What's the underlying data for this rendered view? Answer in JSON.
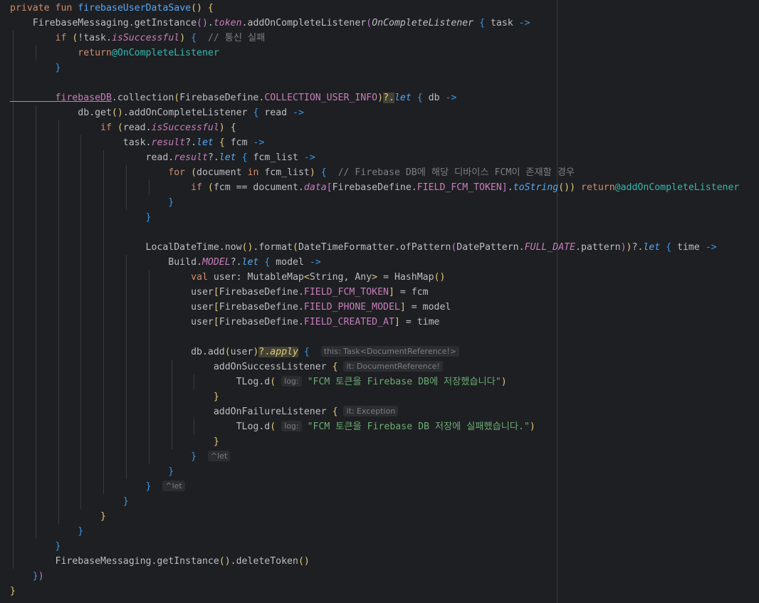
{
  "editor": {
    "language": "Kotlin",
    "lines": [
      [
        [
          "kw",
          "private fun "
        ],
        [
          "fn",
          "firebaseUserDataSave"
        ],
        [
          "brace1",
          "() {"
        ]
      ],
      [
        [
          "plain",
          "    FirebaseMessaging.getInstance"
        ],
        [
          "brace2",
          "()"
        ],
        [
          "plain",
          "."
        ],
        [
          "ital",
          "token"
        ],
        [
          "plain",
          ".addOnCompleteListener"
        ],
        [
          "brace2",
          "("
        ],
        [
          "type",
          "OnCompleteListener"
        ],
        [
          "plain",
          " "
        ],
        [
          "brace3",
          "{"
        ],
        [
          "plain",
          " task "
        ],
        [
          "arrow",
          "->"
        ]
      ],
      [
        [
          "kw",
          "        if "
        ],
        [
          "brace1",
          "("
        ],
        [
          "plain",
          "!task."
        ],
        [
          "ital",
          "isSuccessful"
        ],
        [
          "brace1",
          ")"
        ],
        [
          "plain",
          " "
        ],
        [
          "brace3",
          "{"
        ],
        [
          "comment",
          "  // 통신 실패"
        ]
      ],
      [
        [
          "kw",
          "            return"
        ],
        [
          "label",
          "@OnCompleteListener"
        ]
      ],
      [
        [
          "brace3",
          "        }"
        ]
      ],
      [
        [
          "plain",
          ""
        ]
      ],
      [
        [
          "under",
          "        firebaseDB"
        ],
        [
          "plain",
          ".collection"
        ],
        [
          "brace1",
          "("
        ],
        [
          "plain",
          "FirebaseDefine."
        ],
        [
          "static",
          "COLLECTION_USER_INFO"
        ],
        [
          "brace1",
          ")"
        ],
        [
          "hl",
          "?."
        ],
        [
          "ext",
          "let"
        ],
        [
          "plain",
          " "
        ],
        [
          "brace3",
          "{"
        ],
        [
          "plain",
          " db "
        ],
        [
          "arrow",
          "->"
        ]
      ],
      [
        [
          "plain",
          "            db.get"
        ],
        [
          "brace1",
          "()"
        ],
        [
          "plain",
          ".addOnCompleteListener "
        ],
        [
          "brace3",
          "{"
        ],
        [
          "plain",
          " read "
        ],
        [
          "arrow",
          "->"
        ]
      ],
      [
        [
          "kw",
          "                if "
        ],
        [
          "brace1",
          "("
        ],
        [
          "plain",
          "read."
        ],
        [
          "ital",
          "isSuccessful"
        ],
        [
          "brace1",
          ")"
        ],
        [
          "plain",
          " "
        ],
        [
          "brace1",
          "{"
        ]
      ],
      [
        [
          "plain",
          "                    task."
        ],
        [
          "ital",
          "result"
        ],
        [
          "plain",
          "?."
        ],
        [
          "ext",
          "let"
        ],
        [
          "plain",
          " "
        ],
        [
          "brace4",
          "{"
        ],
        [
          "plain",
          " fcm "
        ],
        [
          "arrow",
          "->"
        ]
      ],
      [
        [
          "plain",
          "                        read."
        ],
        [
          "ital",
          "result"
        ],
        [
          "plain",
          "?."
        ],
        [
          "ext",
          "let"
        ],
        [
          "plain",
          " "
        ],
        [
          "brace3",
          "{"
        ],
        [
          "plain",
          " fcm_list "
        ],
        [
          "arrow",
          "->"
        ]
      ],
      [
        [
          "kw",
          "                            for "
        ],
        [
          "brace1",
          "("
        ],
        [
          "plain",
          "document "
        ],
        [
          "kw",
          "in"
        ],
        [
          "plain",
          " fcm_list"
        ],
        [
          "brace1",
          ")"
        ],
        [
          "plain",
          " "
        ],
        [
          "brace3",
          "{"
        ],
        [
          "comment",
          "  // Firebase DB에 해당 디바이스 FCM이 존재할 경우"
        ]
      ],
      [
        [
          "kw",
          "                                if "
        ],
        [
          "brace1",
          "("
        ],
        [
          "plain",
          "fcm == document."
        ],
        [
          "ital",
          "data"
        ],
        [
          "brace2",
          "["
        ],
        [
          "plain",
          "FirebaseDefine."
        ],
        [
          "static",
          "FIELD_FCM_TOKEN"
        ],
        [
          "brace2",
          "]"
        ],
        [
          "plain",
          "."
        ],
        [
          "fnit",
          "toString"
        ],
        [
          "brace1",
          "()"
        ],
        [
          "brace1",
          ")"
        ],
        [
          "kw",
          " return"
        ],
        [
          "label",
          "@addOnCompleteListener"
        ]
      ],
      [
        [
          "brace3",
          "                            }"
        ]
      ],
      [
        [
          "brace3",
          "                        }"
        ]
      ],
      [
        [
          "plain",
          ""
        ]
      ],
      [
        [
          "plain",
          "                        LocalDateTime.now"
        ],
        [
          "brace1",
          "()"
        ],
        [
          "plain",
          ".format"
        ],
        [
          "brace1",
          "("
        ],
        [
          "plain",
          "DateTimeFormatter.ofPattern"
        ],
        [
          "brace2",
          "("
        ],
        [
          "plain",
          "DatePattern."
        ],
        [
          "staticit",
          "FULL_DATE"
        ],
        [
          "plain",
          ".pattern"
        ],
        [
          "brace2",
          ")"
        ],
        [
          "brace1",
          ")"
        ],
        [
          "plain",
          "?."
        ],
        [
          "ext",
          "let"
        ],
        [
          "plain",
          " "
        ],
        [
          "brace3",
          "{"
        ],
        [
          "plain",
          " time "
        ],
        [
          "arrow",
          "->"
        ]
      ],
      [
        [
          "plain",
          "                            Build."
        ],
        [
          "staticit",
          "MODEL"
        ],
        [
          "plain",
          "?."
        ],
        [
          "ext",
          "let"
        ],
        [
          "plain",
          " "
        ],
        [
          "brace3",
          "{"
        ],
        [
          "plain",
          " model "
        ],
        [
          "arrow",
          "->"
        ]
      ],
      [
        [
          "kw",
          "                                val "
        ],
        [
          "plain",
          "user: MutableMap"
        ],
        [
          "brace1",
          "<"
        ],
        [
          "plain",
          "String, Any"
        ],
        [
          "brace1",
          ">"
        ],
        [
          "plain",
          " = HashMap"
        ],
        [
          "brace1",
          "()"
        ]
      ],
      [
        [
          "plain",
          "                                user"
        ],
        [
          "brace1",
          "["
        ],
        [
          "plain",
          "FirebaseDefine."
        ],
        [
          "static",
          "FIELD_FCM_TOKEN"
        ],
        [
          "brace1",
          "]"
        ],
        [
          "plain",
          " = fcm"
        ]
      ],
      [
        [
          "plain",
          "                                user"
        ],
        [
          "brace1",
          "["
        ],
        [
          "plain",
          "FirebaseDefine."
        ],
        [
          "static",
          "FIELD_PHONE_MODEL"
        ],
        [
          "brace1",
          "]"
        ],
        [
          "plain",
          " = model"
        ]
      ],
      [
        [
          "plain",
          "                                user"
        ],
        [
          "brace1",
          "["
        ],
        [
          "plain",
          "FirebaseDefine."
        ],
        [
          "static",
          "FIELD_CREATED_AT"
        ],
        [
          "brace1",
          "]"
        ],
        [
          "plain",
          " = time"
        ]
      ],
      [
        [
          "plain",
          ""
        ]
      ],
      [
        [
          "plain",
          "                                db.add"
        ],
        [
          "brace1",
          "("
        ],
        [
          "plain",
          "user"
        ],
        [
          "brace1",
          ")"
        ],
        [
          "hl",
          "?."
        ],
        [
          "hlit",
          "apply"
        ],
        [
          "plain",
          " "
        ],
        [
          "brace3",
          "{"
        ],
        [
          "plain",
          "  "
        ],
        [
          "hint",
          "this: Task<DocumentReference!>"
        ]
      ],
      [
        [
          "plain",
          "                                    addOnSuccessListener "
        ],
        [
          "brace1",
          "{"
        ],
        [
          "plain",
          " "
        ],
        [
          "hint",
          "it: DocumentReference!"
        ]
      ],
      [
        [
          "plain",
          "                                        TLog.d"
        ],
        [
          "brace1",
          "("
        ],
        [
          "plain",
          " "
        ],
        [
          "hint",
          "log:"
        ],
        [
          "plain",
          " "
        ],
        [
          "str",
          "\"FCM 토큰을 Firebase DB에 저장했습니다\""
        ],
        [
          "brace1",
          ")"
        ]
      ],
      [
        [
          "brace1",
          "                                    }"
        ]
      ],
      [
        [
          "plain",
          "                                    addOnFailureListener "
        ],
        [
          "brace1",
          "{"
        ],
        [
          "plain",
          " "
        ],
        [
          "hint",
          "it: Exception"
        ]
      ],
      [
        [
          "plain",
          "                                        TLog.d"
        ],
        [
          "brace1",
          "("
        ],
        [
          "plain",
          " "
        ],
        [
          "hint",
          "log:"
        ],
        [
          "plain",
          " "
        ],
        [
          "str",
          "\"FCM 토큰을 Firebase DB 저장에 실패했습니다.\""
        ],
        [
          "brace1",
          ")"
        ]
      ],
      [
        [
          "brace1",
          "                                    }"
        ]
      ],
      [
        [
          "brace3",
          "                                }"
        ],
        [
          "plain",
          "  "
        ],
        [
          "hint",
          "^let"
        ]
      ],
      [
        [
          "brace3",
          "                            }"
        ]
      ],
      [
        [
          "brace3",
          "                        }"
        ],
        [
          "plain",
          "  "
        ],
        [
          "hint",
          "^let"
        ]
      ],
      [
        [
          "brace6",
          "                    }"
        ]
      ],
      [
        [
          "brace1",
          "                }"
        ]
      ],
      [
        [
          "brace3",
          "            }"
        ]
      ],
      [
        [
          "brace3",
          "        }"
        ]
      ],
      [
        [
          "plain",
          "        FirebaseMessaging.getInstance"
        ],
        [
          "brace1",
          "()"
        ],
        [
          "plain",
          ".deleteToken"
        ],
        [
          "brace1",
          "()"
        ]
      ],
      [
        [
          "brace3",
          "    }"
        ],
        [
          "brace2",
          ")"
        ]
      ],
      [
        [
          "brace1",
          "}"
        ]
      ]
    ]
  }
}
